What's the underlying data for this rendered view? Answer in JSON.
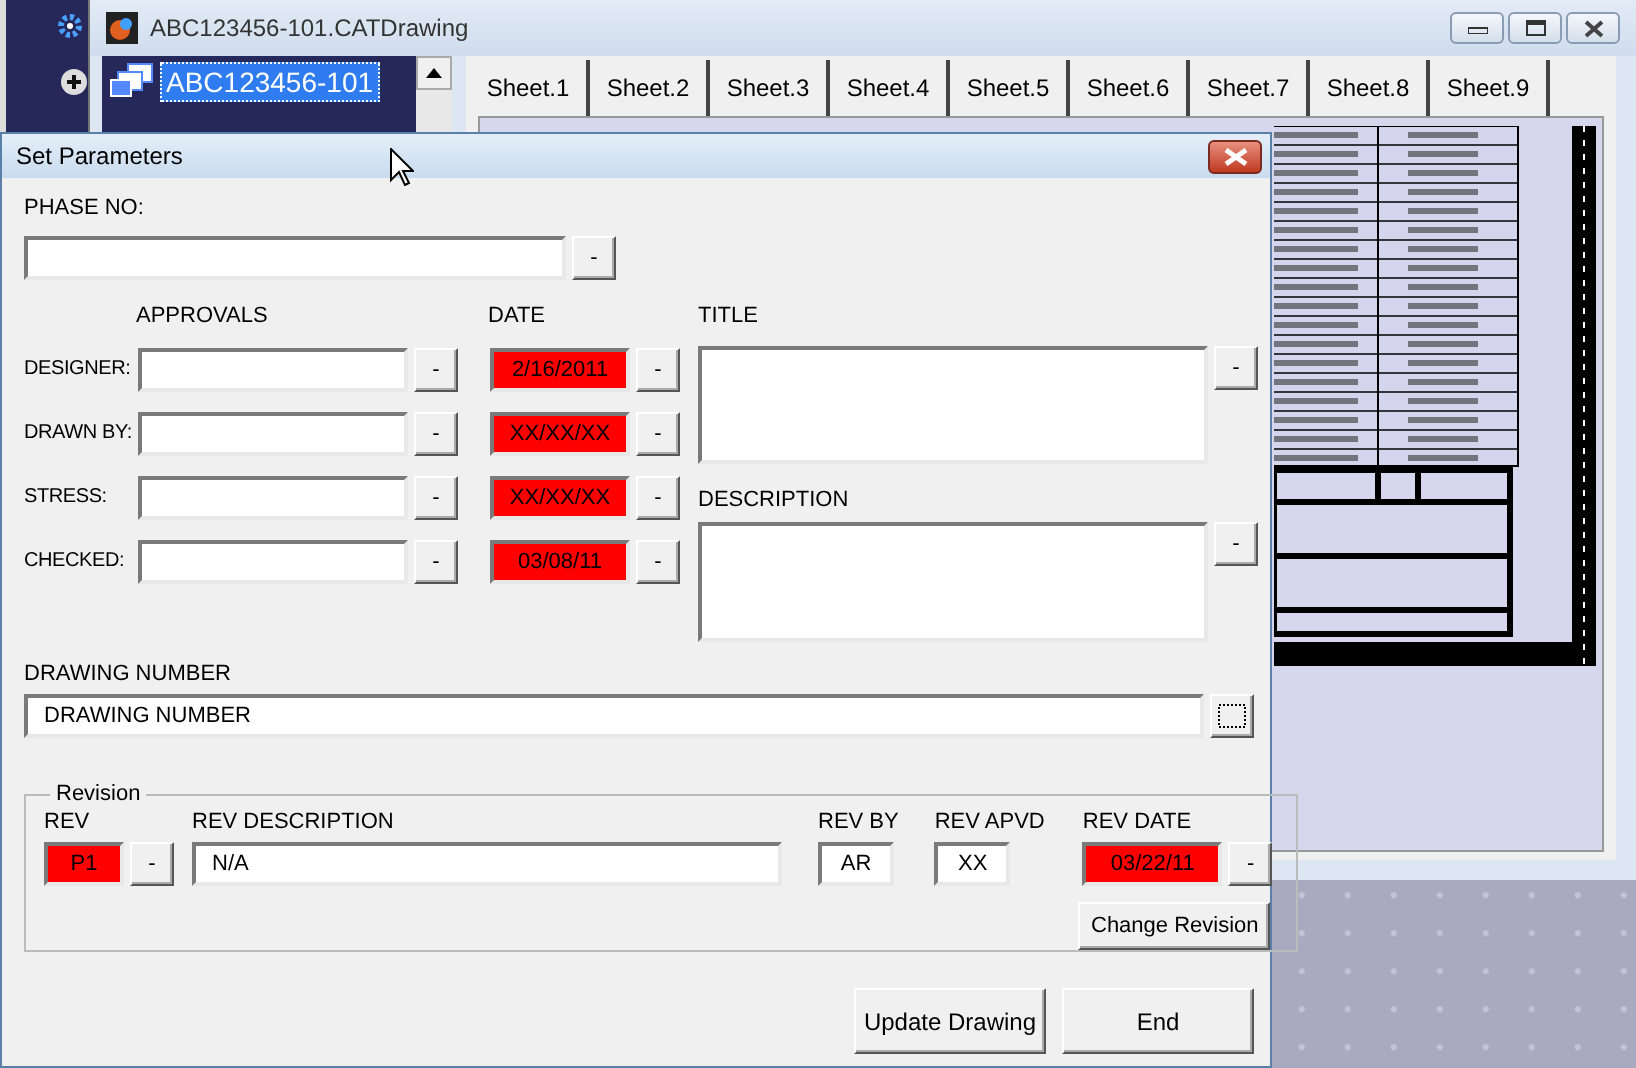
{
  "app_window": {
    "title": "ABC123456-101.CATDrawing",
    "tree": {
      "root": "ABC123456-101",
      "selected": true
    },
    "tabs": [
      {
        "label": "Sheet.1",
        "selected": false
      },
      {
        "label": "Sheet.2",
        "selected": false
      },
      {
        "label": "Sheet.3",
        "selected": false
      },
      {
        "label": "Sheet.4",
        "selected": false
      },
      {
        "label": "Sheet.5",
        "selected": false
      },
      {
        "label": "Sheet.6",
        "selected": false
      },
      {
        "label": "Sheet.7",
        "selected": false
      },
      {
        "label": "Sheet.8",
        "selected": false
      },
      {
        "label": "Sheet.9",
        "selected": false
      }
    ]
  },
  "dialog": {
    "title": "Set Parameters",
    "phase": {
      "label": "PHASE NO:",
      "button": "-"
    },
    "approvals": {
      "heading": "APPROVALS",
      "date_heading": "DATE",
      "rows": [
        {
          "label": "DESIGNER:",
          "button": "-",
          "date": "2/16/2011",
          "date_flagged": true,
          "date_button": "-"
        },
        {
          "label": "DRAWN BY:",
          "button": "-",
          "date": "XX/XX/XX",
          "date_flagged": true,
          "date_button": "-"
        },
        {
          "label": "STRESS:",
          "button": "-",
          "date": "XX/XX/XX",
          "date_flagged": true,
          "date_button": "-"
        },
        {
          "label": "CHECKED:",
          "button": "-",
          "date": "03/08/11",
          "date_flagged": true,
          "date_button": "-"
        }
      ]
    },
    "title_field": {
      "label": "TITLE",
      "button": "-"
    },
    "description_field": {
      "label": "DESCRIPTION",
      "button": "-"
    },
    "drawing_number": {
      "label": "DRAWING NUMBER",
      "value": "DRAWING NUMBER"
    },
    "revision": {
      "label": "Revision",
      "fields": [
        {
          "label": "REV",
          "value": "P1",
          "flagged": true,
          "button": "-"
        },
        {
          "label": "REV DESCRIPTION",
          "value": "N/A",
          "flagged": false
        },
        {
          "label": "REV BY",
          "value": "AR",
          "flagged": false
        },
        {
          "label": "REV APVD",
          "value": "XX",
          "flagged": false
        },
        {
          "label": "REV DATE",
          "value": "03/22/11",
          "flagged": true,
          "button": "-"
        }
      ],
      "change_button": "Change Revision"
    },
    "actions": [
      "Update Drawing",
      "End"
    ]
  }
}
